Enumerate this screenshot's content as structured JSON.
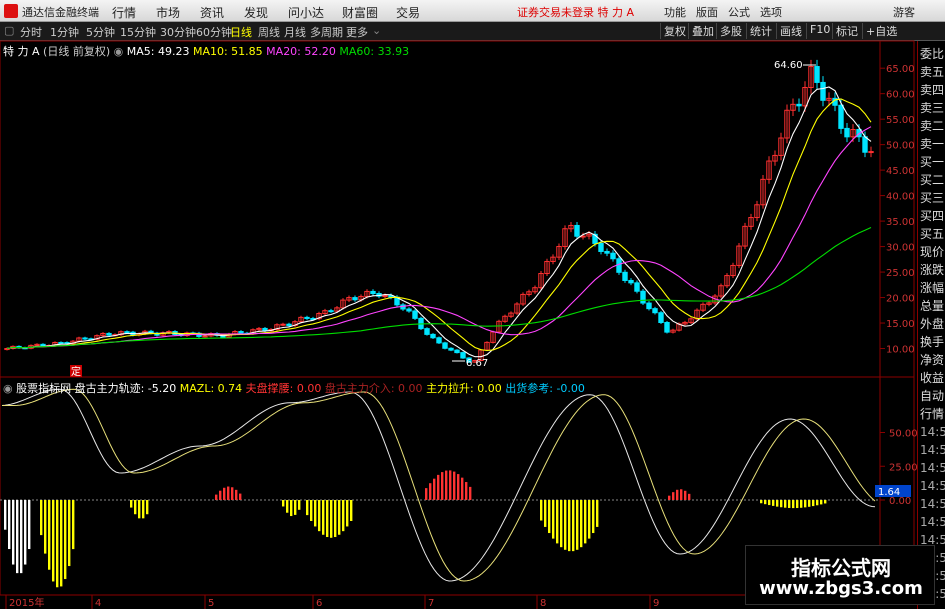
{
  "titlebar": {
    "app_name": "通达信金融终端",
    "menus": [
      "行情",
      "市场",
      "资讯",
      "发现",
      "问小达",
      "财富圈",
      "交易"
    ],
    "notice": "证券交易未登录  特 力 A",
    "right_menus": [
      "功能",
      "版面",
      "公式",
      "选项"
    ],
    "guest": "游客"
  },
  "toolbar": {
    "periods": [
      "分时",
      "1分钟",
      "5分钟",
      "15分钟",
      "30分钟",
      "60分钟",
      "日线",
      "周线",
      "月线",
      "多周期",
      "更多"
    ],
    "active_period": "日线",
    "right_buttons": [
      "复权",
      "叠加",
      "多股",
      "统计",
      "画线",
      "F10",
      "标记",
      "+自选"
    ]
  },
  "main_legend": {
    "stock": "特 力 A",
    "mode": "(日线 前复权)",
    "ma": [
      {
        "label": "MA5: 49.23",
        "color": "#ffffff"
      },
      {
        "label": "MA10: 51.85",
        "color": "#ffff00"
      },
      {
        "label": "MA20: 52.20",
        "color": "#ff44ff"
      },
      {
        "label": "MA60: 33.93",
        "color": "#00dd00"
      }
    ]
  },
  "sub_legend": {
    "name": "股票指标网",
    "items": [
      {
        "label": "盘古主力轨迹: -5.20",
        "color": "#ffffff"
      },
      {
        "label": "MAZL: 0.74",
        "color": "#ffff00"
      },
      {
        "label": "夫盘撑腰: 0.00",
        "color": "#ff3333"
      },
      {
        "label": "盘古主力介入: 0.00",
        "color": "#aa2222"
      },
      {
        "label": "主力拉升: 0.00",
        "color": "#ffff00"
      },
      {
        "label": "出货参考: -0.00",
        "color": "#00ccff"
      }
    ]
  },
  "annotations": {
    "high": "64.60",
    "low": "6.67",
    "tag": "定"
  },
  "price_axis": [
    "65.00",
    "60.00",
    "55.00",
    "50.00",
    "45.00",
    "40.00",
    "35.00",
    "30.00",
    "25.00",
    "20.00",
    "15.00",
    "10.00"
  ],
  "sub_axis": [
    "50.00",
    "25.00",
    "0.00"
  ],
  "sub_value_tag": "1.64",
  "time_axis": [
    "2015年",
    "4",
    "5",
    "6",
    "7",
    "8",
    "9"
  ],
  "sidebar": {
    "items": [
      "委比",
      "卖五",
      "卖四",
      "卖三",
      "卖二",
      "卖一",
      "买一",
      "买二",
      "买三",
      "买四",
      "买五",
      "现价",
      "涨跌",
      "涨幅",
      "总量",
      "外盘",
      "换手",
      "净资",
      "收益",
      "自动",
      "行情",
      "14:5",
      "14:5",
      "14:5",
      "14:5",
      "14:5",
      "14:5",
      "14:5",
      "14:5",
      "14:5",
      "14:5"
    ]
  },
  "watermark": {
    "line1": "指标公式网",
    "line2": "www.zbgs3.com"
  },
  "colors": {
    "up": "#ff3030",
    "down": "#00e5ff",
    "ma5": "#ffffff",
    "ma10": "#ffff00",
    "ma20": "#ff44ff",
    "ma60": "#00dd00"
  }
}
